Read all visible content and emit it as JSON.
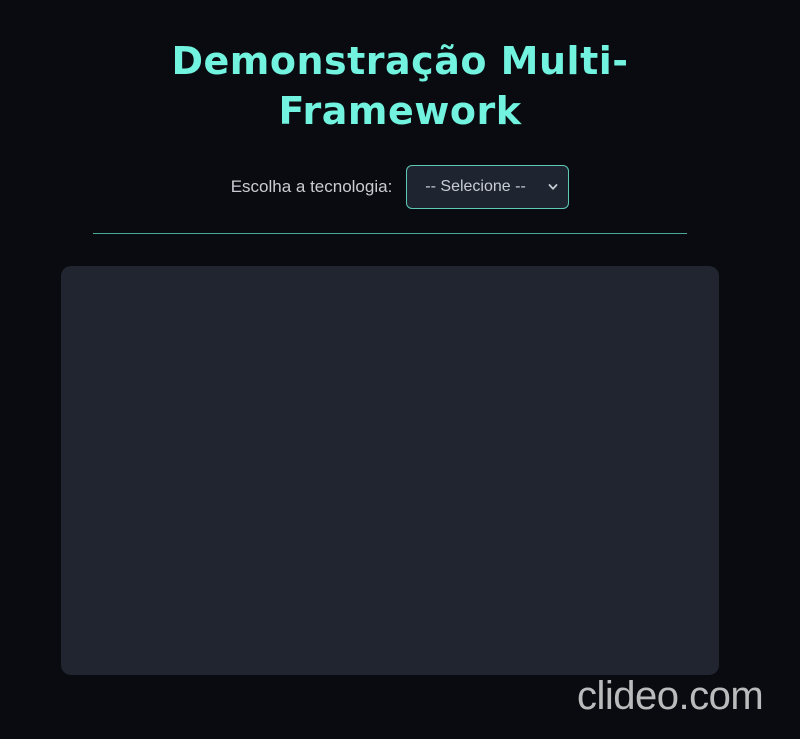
{
  "header": {
    "title_line1": "Demonstração Multi-",
    "title_line2": "Framework"
  },
  "selector": {
    "label": "Escolha a tecnologia:",
    "selected_value": "-- Selecione --",
    "icon": "chevron-down-icon"
  },
  "watermark": {
    "text": "clideo.com"
  },
  "colors": {
    "background": "#0a0b10",
    "title": "#71f3df",
    "accent_border": "#5fc9b8",
    "panel": "#20252f"
  }
}
